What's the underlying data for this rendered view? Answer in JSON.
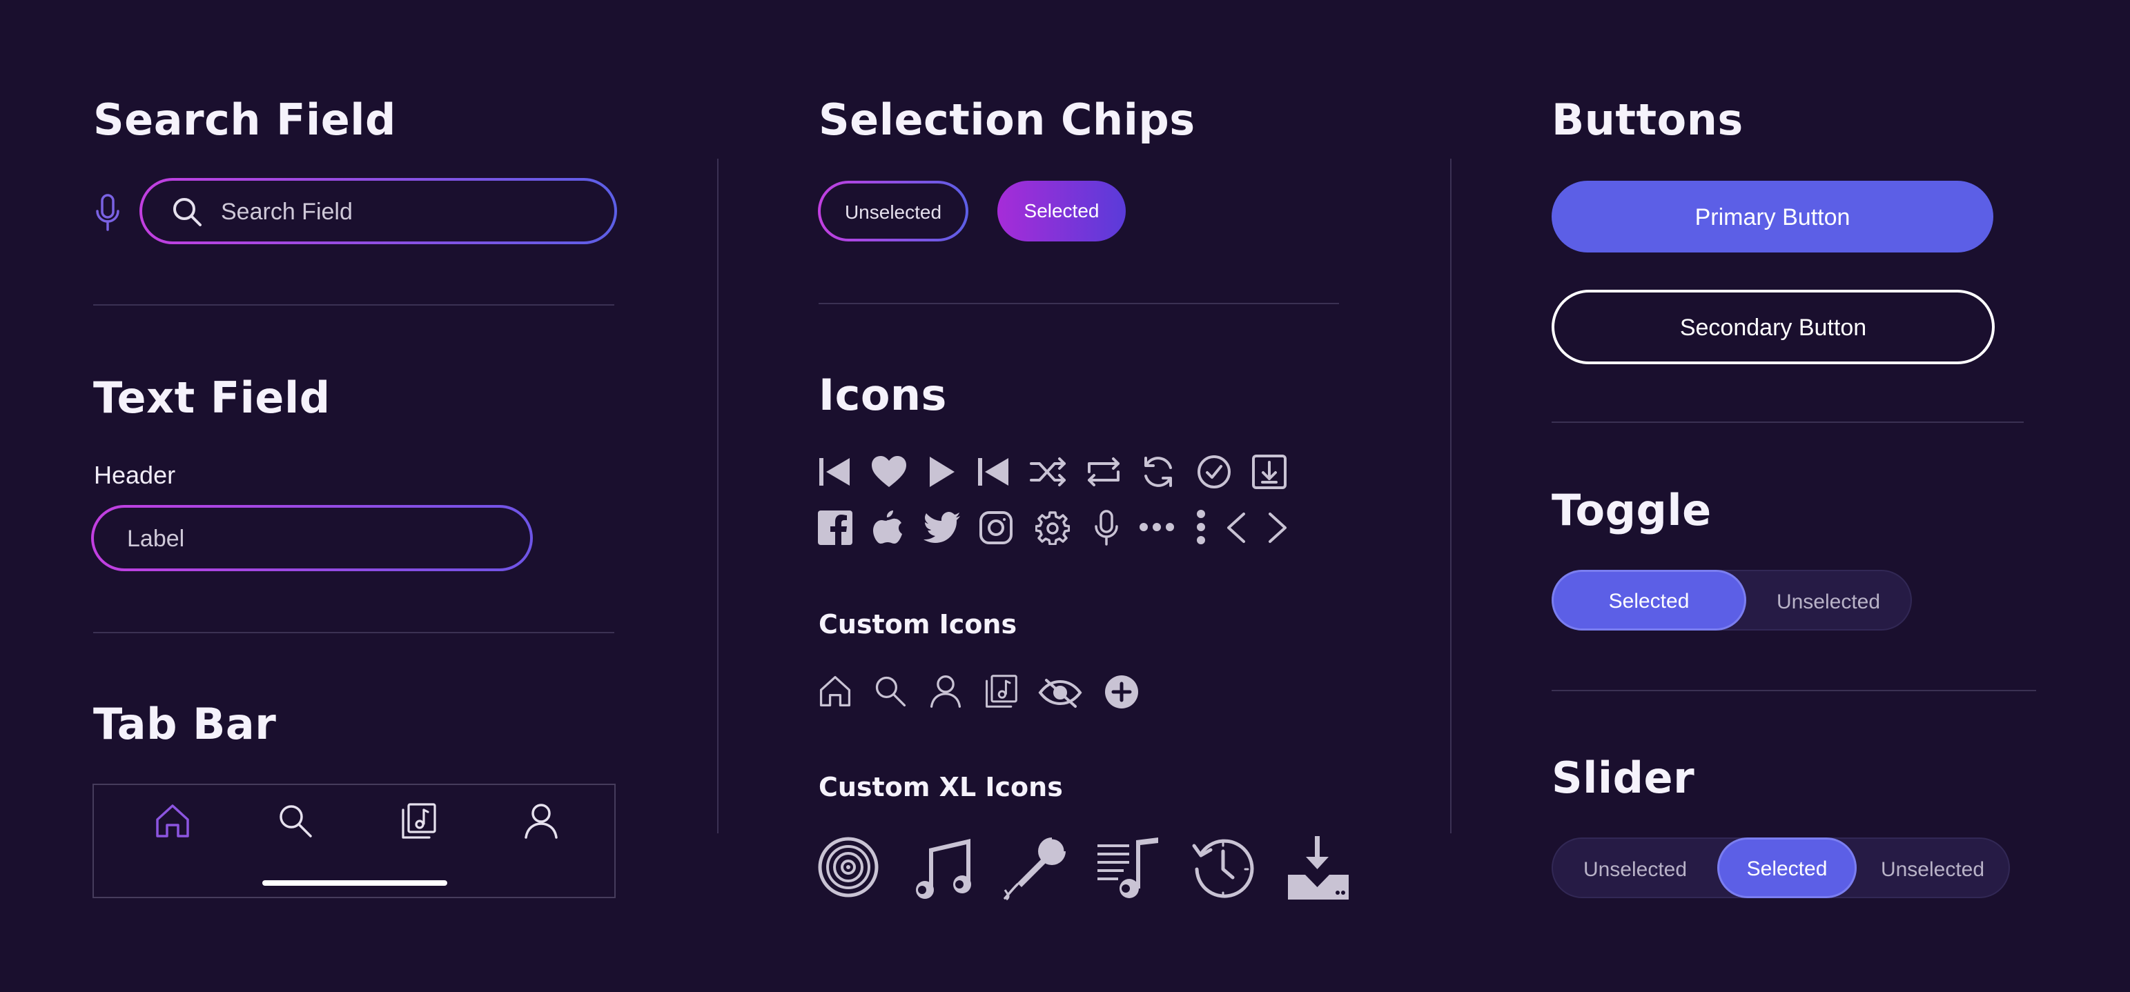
{
  "search": {
    "title": "Search Field",
    "placeholder": "Search Field"
  },
  "textfield": {
    "title": "Text Field",
    "header": "Header",
    "label": "Label"
  },
  "tabbar": {
    "title": "Tab Bar"
  },
  "chips": {
    "title": "Selection Chips",
    "unselected": "Unselected",
    "selected": "Selected"
  },
  "icons": {
    "title": "Icons",
    "custom_title": "Custom Icons",
    "xl_title": "Custom XL Icons"
  },
  "buttons": {
    "title": "Buttons",
    "primary": "Primary Button",
    "secondary": "Secondary Button"
  },
  "toggle": {
    "title": "Toggle",
    "selected": "Selected",
    "unselected": "Unselected"
  },
  "slider": {
    "title": "Slider",
    "left": "Unselected",
    "middle": "Selected",
    "right": "Unselected"
  },
  "colors": {
    "background": "#1a0f2e",
    "accent": "#5c5fe6",
    "gradient_start": "#c23fe0",
    "gradient_end": "#5c5fe6",
    "tab_active": "#8c55e0"
  }
}
